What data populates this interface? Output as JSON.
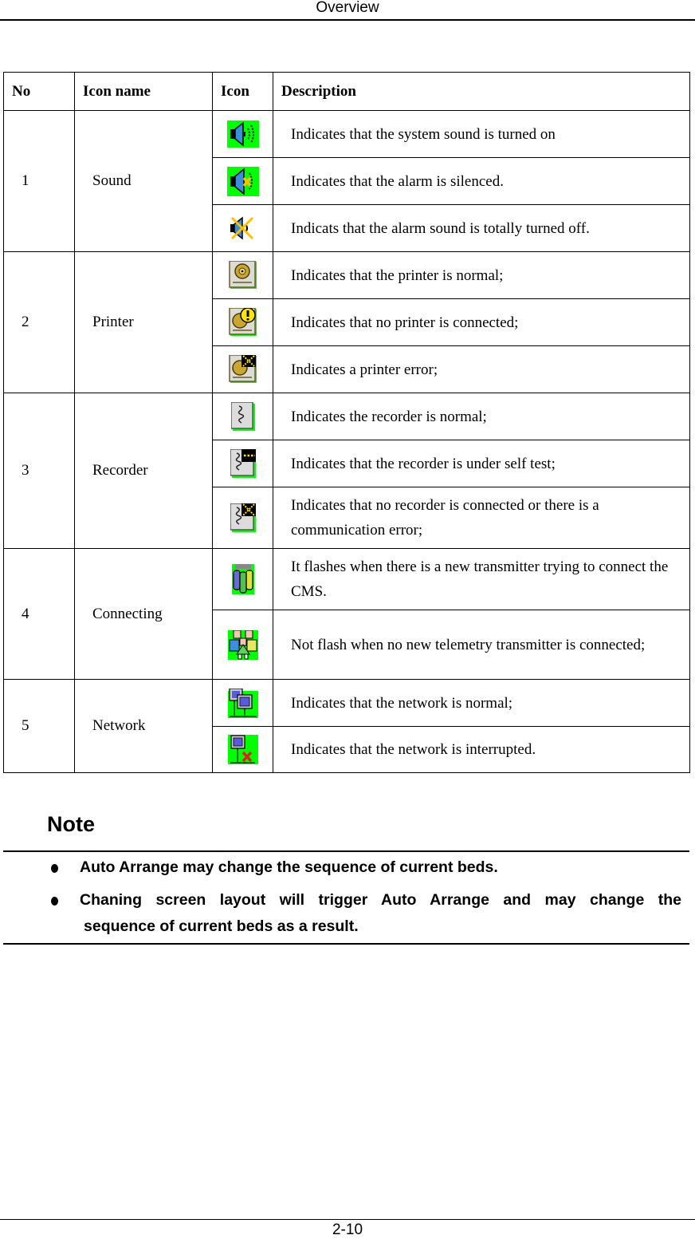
{
  "header": {
    "title": "Overview"
  },
  "footer": {
    "page_number": "2-10"
  },
  "table": {
    "columns": [
      "No",
      "Icon name",
      "Icon",
      "Description"
    ],
    "groups": [
      {
        "no": "1",
        "name": "Sound",
        "rows": [
          {
            "icon": "sound-on-icon",
            "description": "Indicates that the system sound is turned on"
          },
          {
            "icon": "alarm-silenced-icon",
            "description": "Indicates that the alarm is silenced."
          },
          {
            "icon": "alarm-sound-off-icon",
            "description": "Indicats that the alarm sound is totally turned off."
          }
        ]
      },
      {
        "no": "2",
        "name": "Printer",
        "rows": [
          {
            "icon": "printer-normal-icon",
            "description": "Indicates that the printer is normal;"
          },
          {
            "icon": "printer-not-connected-icon",
            "description": "Indicates that no printer is connected;"
          },
          {
            "icon": "printer-error-icon",
            "description": "Indicates a printer error;"
          }
        ]
      },
      {
        "no": "3",
        "name": "Recorder",
        "rows": [
          {
            "icon": "recorder-normal-icon",
            "description": "Indicates the recorder is normal;"
          },
          {
            "icon": "recorder-self-test-icon",
            "description": "Indicates that the recorder is under self test;"
          },
          {
            "icon": "recorder-error-icon",
            "description": "Indicates that no recorder is connected or there is a communication error;"
          }
        ]
      },
      {
        "no": "4",
        "name": "Connecting",
        "rows": [
          {
            "icon": "transmitter-connecting-icon",
            "description": "It flashes when there is a new transmitter trying to connect the CMS."
          },
          {
            "icon": "transmitter-idle-icon",
            "description": "Not flash when no new telemetry transmitter is connected;"
          }
        ]
      },
      {
        "no": "5",
        "name": "Network",
        "rows": [
          {
            "icon": "network-normal-icon",
            "description": "Indicates that the network is normal;"
          },
          {
            "icon": "network-interrupted-icon",
            "description": "Indicates that the network is interrupted."
          }
        ]
      }
    ]
  },
  "note": {
    "title": "Note",
    "items": [
      "Auto Arrange may change the sequence of current beds.",
      "Chaning screen layout will trigger Auto Arrange and may change the",
      "sequence of current beds as a result."
    ]
  },
  "colors": {
    "icon_bg_green": "#00ff00",
    "speaker_blue": "#3b8fd8",
    "warning_yellow": "#ffe000",
    "error_red": "#e02020"
  }
}
